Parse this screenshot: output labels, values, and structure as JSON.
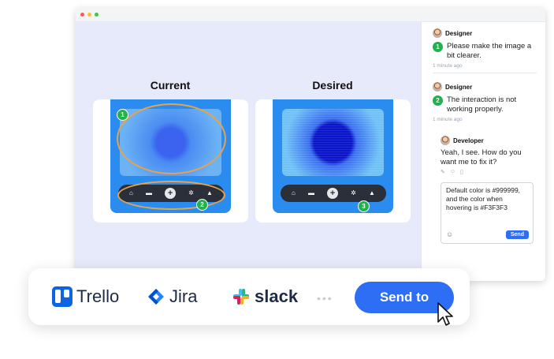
{
  "window": {
    "traffic_colors": [
      "#f25f58",
      "#fbbe2e",
      "#3dc93f"
    ],
    "columns": {
      "current": {
        "title": "Current",
        "markers": [
          "1",
          "2"
        ]
      },
      "desired": {
        "title": "Desired",
        "markers": [
          "3"
        ]
      }
    },
    "nav_icons": [
      "home-icon",
      "folder-icon",
      "plus-icon",
      "gear-icon",
      "bell-icon"
    ]
  },
  "sidebar": {
    "comments": [
      {
        "author": "Designer",
        "number": "1",
        "text": "Please make the image a bit clearer.",
        "time": "1 minute ago"
      },
      {
        "author": "Designer",
        "number": "2",
        "text": "The interaction is not working properly.",
        "time": "1 minute ago"
      }
    ],
    "reply": {
      "author": "Developer",
      "text": "Yeah, I see. How do you want me to fix it?",
      "actions": [
        "edit-icon",
        "emoji-icon",
        "trash-icon"
      ]
    },
    "input": {
      "value": "Default color is #999999, and the color when hovering is #F3F3F3",
      "send_label": "Send"
    }
  },
  "integrations": {
    "items": [
      "Trello",
      "Jira",
      "slack"
    ],
    "more": "•••",
    "send_to_label": "Send to",
    "accent": "#2d6ef5"
  }
}
